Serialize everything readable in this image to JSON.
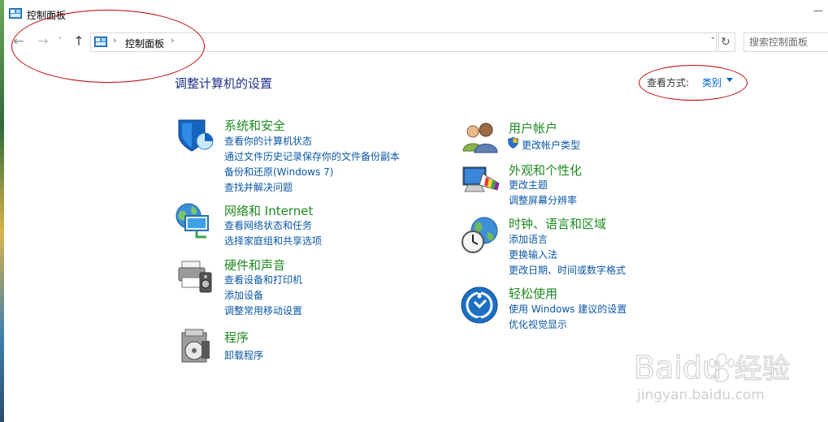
{
  "window": {
    "title": "控制面板",
    "dash": "—"
  },
  "nav": {
    "back": "←",
    "forward": "→",
    "recent": "˅",
    "up": "↑"
  },
  "address": {
    "separator": "›",
    "path": "控制面板",
    "dropdown": "˅",
    "refresh": "↻"
  },
  "search": {
    "placeholder": "搜索控制面板"
  },
  "content": {
    "title": "调整计算机的设置",
    "view_by_label": "查看方式:",
    "view_by_value": "类别"
  },
  "categories_left": [
    {
      "title": "系统和安全",
      "icon": "shield-pie-icon",
      "links": [
        "查看你的计算机状态",
        "通过文件历史记录保存你的文件备份副本",
        "备份和还原(Windows 7)",
        "查找并解决问题"
      ]
    },
    {
      "title": "网络和 Internet",
      "icon": "globe-network-icon",
      "links": [
        "查看网络状态和任务",
        "选择家庭组和共享选项"
      ]
    },
    {
      "title": "硬件和声音",
      "icon": "printer-speaker-icon",
      "links": [
        "查看设备和打印机",
        "添加设备",
        "调整常用移动设置"
      ]
    },
    {
      "title": "程序",
      "icon": "programs-disc-icon",
      "links": [
        "卸载程序"
      ]
    }
  ],
  "categories_right": [
    {
      "title": "用户帐户",
      "icon": "users-icon",
      "links": [
        "更改帐户类型"
      ]
    },
    {
      "title": "外观和个性化",
      "icon": "monitor-palette-icon",
      "links": [
        "更改主题",
        "调整屏幕分辨率"
      ]
    },
    {
      "title": "时钟、语言和区域",
      "icon": "clock-globe-icon",
      "links": [
        "添加语言",
        "更换输入法",
        "更改日期、时间或数字格式"
      ]
    },
    {
      "title": "轻松使用",
      "icon": "ease-of-access-icon",
      "links": [
        "使用 Windows 建议的设置",
        "优化视觉显示"
      ]
    }
  ],
  "watermark": {
    "brand": "Baidu",
    "cn": "经验",
    "url": "jingyan.baidu.com"
  },
  "colors": {
    "category_title": "#1d8a21",
    "link": "#0b57a4",
    "page_title": "#1e3287",
    "annotation": "#c00000"
  }
}
